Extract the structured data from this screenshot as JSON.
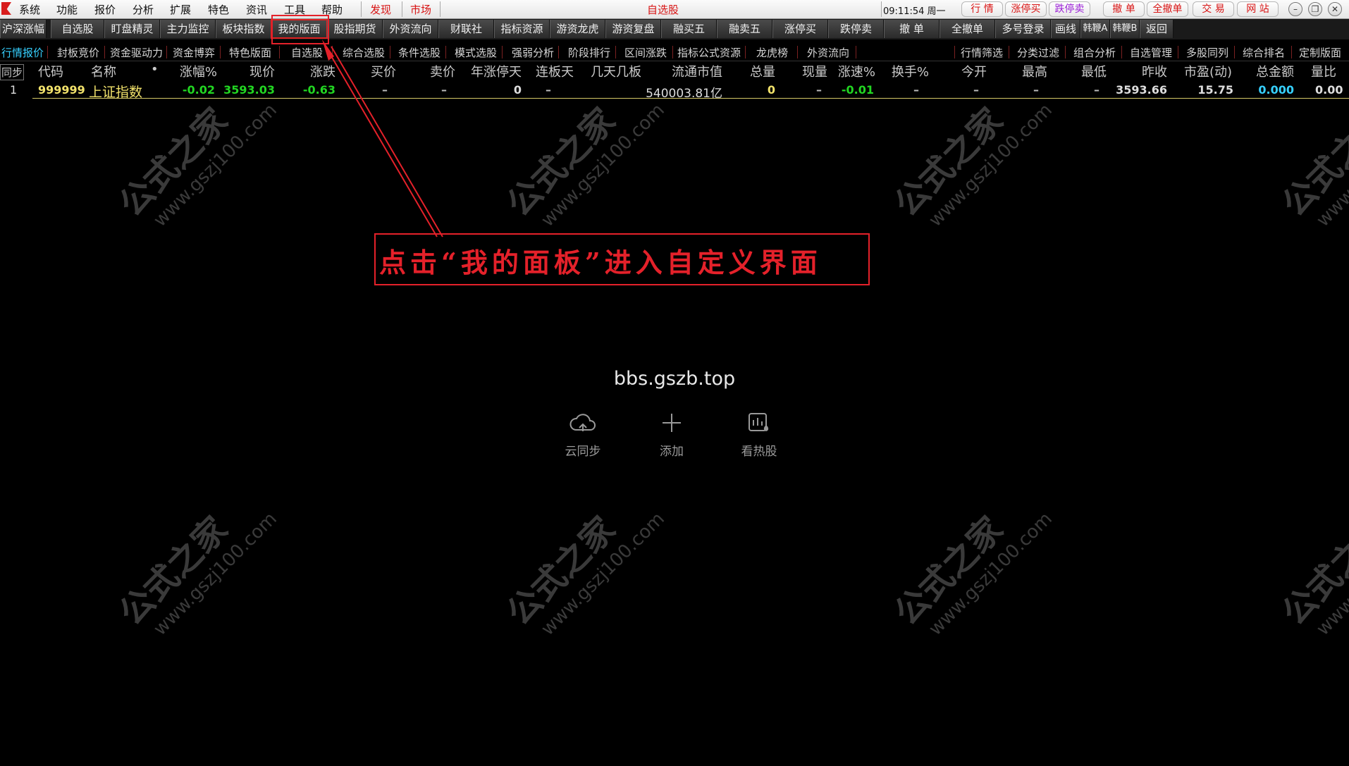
{
  "menu": {
    "items": [
      "系统",
      "功能",
      "报价",
      "分析",
      "扩展",
      "特色",
      "资讯",
      "工具",
      "帮助"
    ],
    "highlight_items": [
      "发现",
      "市场"
    ],
    "window_title": "自选股",
    "clock": "09:11:54 周一",
    "right_buttons": [
      "行 情",
      "涨停买",
      "跌停卖",
      "撤 单",
      "全撤单",
      "交 易",
      "网 站"
    ],
    "window_controls": [
      "–",
      "❐",
      "✕"
    ]
  },
  "toolbar": {
    "buttons": [
      "沪深涨幅",
      "自选股",
      "盯盘精灵",
      "主力监控",
      "板块指数",
      "我的版面",
      "股指期货",
      "外资流向",
      "财联社",
      "指标资源",
      "游资龙虎",
      "游资复盘",
      "融买五",
      "融卖五",
      "涨停买",
      "跌停卖",
      "撤 单",
      "全撤单",
      "多号登录",
      "画线",
      "韩鞭A",
      "韩鞭B",
      "返回"
    ],
    "active_index": 5
  },
  "categories": {
    "left": [
      "行情报价",
      "封板竞价",
      "资金驱动力",
      "资金博弈",
      "特色版面",
      "自选股",
      "综合选股",
      "条件选股",
      "模式选股",
      "强弱分析",
      "阶段排行",
      "区间涨跌",
      "指标公式资源",
      "龙虎榜",
      "外资流向"
    ],
    "right": [
      "行情筛选",
      "分类过滤",
      "组合分析",
      "自选管理",
      "多股同列",
      "综合排名",
      "定制版面"
    ],
    "active_index": 0
  },
  "table": {
    "headers": [
      "同步",
      "代码",
      "名称",
      "•",
      "涨幅%",
      "现价",
      "涨跌",
      "买价",
      "卖价",
      "年涨停天",
      "连板天",
      "几天几板",
      "流通市值",
      "总量",
      "现量",
      "涨速%",
      "换手%",
      "今开",
      "最高",
      "最低",
      "昨收",
      "市盈(动)",
      "总金额",
      "量比"
    ],
    "rows": [
      [
        "1",
        "999999",
        "上证指数",
        "",
        "-0.02",
        "3593.03",
        "-0.63",
        "–",
        "–",
        "0",
        "–",
        "",
        "540003.81亿",
        "0",
        "–",
        "-0.01",
        "–",
        "–",
        "–",
        "–",
        "3593.66",
        "15.75",
        "0.000",
        "0.00"
      ]
    ]
  },
  "watermark": {
    "brand": "公式之家",
    "url": "www.gszj100.com"
  },
  "annotation": {
    "text": "点击“我的面板”进入自定义界面"
  },
  "center": {
    "site": "bbs.gszb.top",
    "actions": [
      {
        "label": "云同步",
        "icon": "cloud-sync-icon"
      },
      {
        "label": "添加",
        "icon": "plus-icon"
      },
      {
        "label": "看热股",
        "icon": "hot-stock-icon"
      }
    ]
  }
}
